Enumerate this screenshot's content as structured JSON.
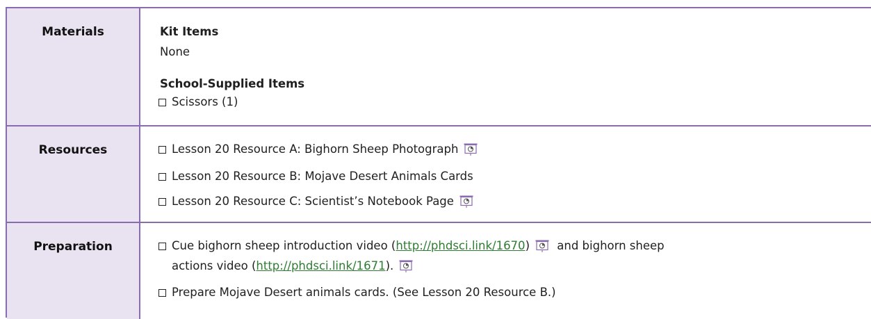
{
  "materials": {
    "label": "Materials",
    "kit_heading": "Kit Items",
    "kit_value": "None",
    "school_heading": "School-Supplied Items",
    "school_items": [
      "Scissors (1)"
    ]
  },
  "resources": {
    "label": "Resources",
    "items": [
      "Lesson 20 Resource A: Bighorn Sheep Photograph",
      "Lesson 20 Resource B: Mojave Desert Animals Cards",
      "Lesson 20 Resource C: Scientist’s Notebook Page"
    ]
  },
  "preparation": {
    "label": "Preparation",
    "item1_part1": "Cue bighorn sheep introduction video (",
    "item1_link1": "http://phdsci.link/1670",
    "item1_part2": ")",
    "item1_part3": " and bighorn sheep",
    "item1_part4": "actions video (",
    "item1_link2": "http://phdsci.link/1671",
    "item1_part5": ").",
    "item2": "Prepare Mojave Desert animals cards. (See Lesson 20 Resource B.)"
  },
  "colors": {
    "border": "#8a6bb0",
    "label_bg": "#e9e2f0",
    "link": "#2e7d32"
  },
  "icon": "projector-screen-icon"
}
